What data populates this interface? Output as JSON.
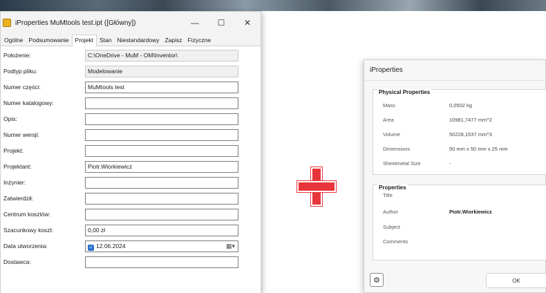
{
  "left_dialog": {
    "title": "iProperties MuMtools test.ipt ([Główny])",
    "tabs": [
      "Ogólne",
      "Podsumowanie",
      "Projekt",
      "Stan",
      "Niestandardowy",
      "Zapisz",
      "Fizyczne"
    ],
    "active_tab": "Projekt",
    "fields": [
      {
        "label": "Położenie:",
        "value": "C:\\OneDrive - MuM - OM\\Inventor\\",
        "readonly": true
      },
      {
        "label": "Podtyp pliku:",
        "value": "Modelowanie",
        "readonly": true
      },
      {
        "label": "Numer części:",
        "value": "MuMtools test"
      },
      {
        "label": "Numer katalogowy:",
        "value": ""
      },
      {
        "label": "Opis:",
        "value": ""
      },
      {
        "label": "Numer wersji:",
        "value": ""
      },
      {
        "label": "Projekt:",
        "value": ""
      },
      {
        "label": "Projektant:",
        "value": "Piotr.Wiorkiewicz"
      },
      {
        "label": "Inżynier:",
        "value": ""
      },
      {
        "label": "Zatwierdził:",
        "value": ""
      },
      {
        "label": "Centrum kosztów:",
        "value": ""
      },
      {
        "label": "Szacunkowy koszt:",
        "value": "0,00 zł"
      },
      {
        "label": "Data utworzenia:",
        "value": "12.06.2024"
      },
      {
        "label": "Dostawca:",
        "value": ""
      }
    ]
  },
  "right_dialog": {
    "title": "iProperties",
    "physical": {
      "heading": "Physical Properties",
      "rows": [
        {
          "key": "Mass",
          "value": "0,0502 kg"
        },
        {
          "key": "Area",
          "value": "10981,7477 mm^2"
        },
        {
          "key": "Volume",
          "value": "50228,1537 mm^3"
        },
        {
          "key": "Dimensions",
          "value": "50 mm x 50 mm x 25 mm"
        },
        {
          "key": "Sheetmetal Size",
          "value": "-"
        }
      ]
    },
    "properties": {
      "heading": "Properties",
      "rows": [
        {
          "key": "Title",
          "value": ""
        },
        {
          "key": "Author",
          "value": "Piotr.Wiorkiewicz"
        },
        {
          "key": "Subject",
          "value": ""
        },
        {
          "key": "Comments",
          "value": ""
        }
      ]
    },
    "ok_label": "OK"
  },
  "icons": {
    "gear": "gear-icon",
    "plus": "plus-icon",
    "calendar": "calendar-icon"
  },
  "colors": {
    "plus": "#e8343b",
    "checkbox": "#2b6fd1",
    "app_icon": "#e8b21f"
  }
}
